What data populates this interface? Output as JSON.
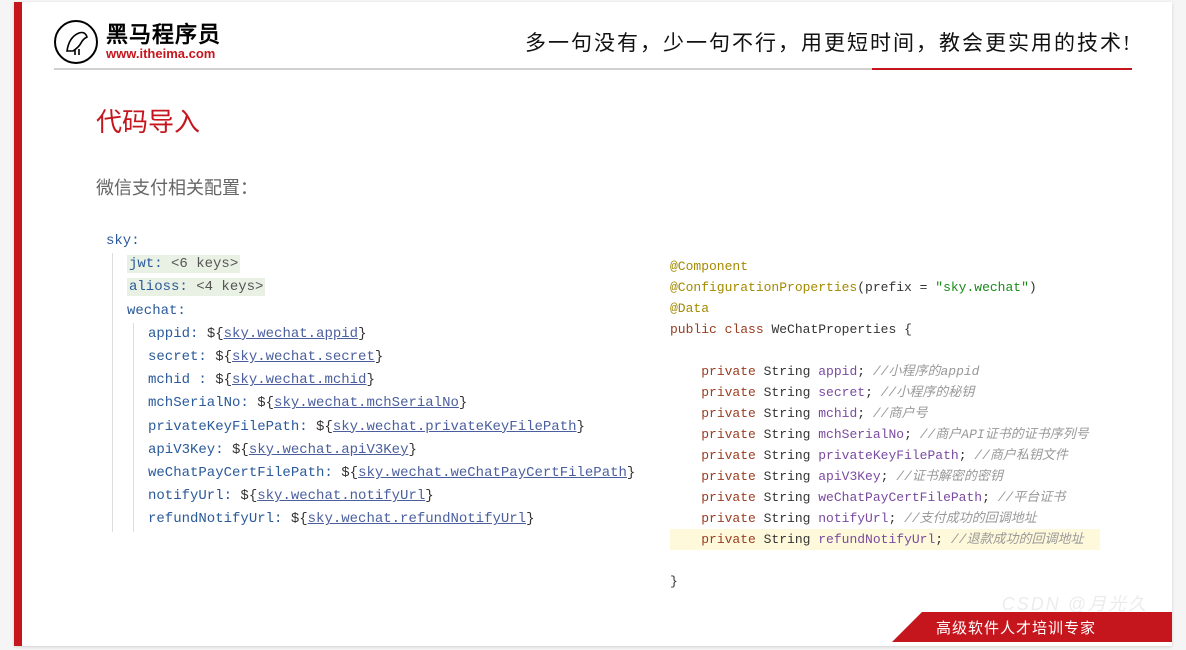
{
  "logo": {
    "cn": "黑马程序员",
    "url": "www.itheima.com"
  },
  "tagline": "多一句没有，少一句不行，用更短时间，教会更实用的技术!",
  "title": "代码导入",
  "subtitle": "微信支付相关配置：",
  "yaml": {
    "root": "sky:",
    "jwt_key": "jwt:",
    "jwt_val": "<6 keys>",
    "alioss_key": "alioss:",
    "alioss_val": "<4 keys>",
    "wechat_key": "wechat:",
    "items": [
      {
        "key": "appid:",
        "prefix": "${",
        "link": "sky.wechat.appid",
        "suffix": "}"
      },
      {
        "key": "secret:",
        "prefix": "${",
        "link": "sky.wechat.secret",
        "suffix": "}"
      },
      {
        "key": "mchid :",
        "prefix": "${",
        "link": "sky.wechat.mchid",
        "suffix": "}"
      },
      {
        "key": "mchSerialNo:",
        "prefix": "${",
        "link": "sky.wechat.mchSerialNo",
        "suffix": "}"
      },
      {
        "key": "privateKeyFilePath:",
        "prefix": "${",
        "link": "sky.wechat.privateKeyFilePath",
        "suffix": "}"
      },
      {
        "key": "apiV3Key:",
        "prefix": "${",
        "link": "sky.wechat.apiV3Key",
        "suffix": "}"
      },
      {
        "key": "weChatPayCertFilePath:",
        "prefix": "${",
        "link": "sky.wechat.weChatPayCertFilePath",
        "suffix": "}"
      },
      {
        "key": "notifyUrl:",
        "prefix": "${",
        "link": "sky.wechat.notifyUrl",
        "suffix": "}"
      },
      {
        "key": "refundNotifyUrl:",
        "prefix": "${",
        "link": "sky.wechat.refundNotifyUrl",
        "suffix": "}"
      }
    ]
  },
  "java": {
    "a1": "@Component",
    "a2_name": "@ConfigurationProperties",
    "a2_arg_k": "prefix = ",
    "a2_arg_v": "\"sky.wechat\"",
    "a3": "@Data",
    "kw_public": "public",
    "kw_class": "class",
    "cls": "WeChatProperties",
    "brace_open": "{",
    "brace_close": "}",
    "kw_private": "private",
    "ty_string": "String",
    "fields": [
      {
        "name": "appid",
        "comment": "//小程序的appid"
      },
      {
        "name": "secret",
        "comment": "//小程序的秘钥"
      },
      {
        "name": "mchid",
        "comment": "//商户号"
      },
      {
        "name": "mchSerialNo",
        "comment": "//商户API证书的证书序列号"
      },
      {
        "name": "privateKeyFilePath",
        "comment": "//商户私钥文件"
      },
      {
        "name": "apiV3Key",
        "comment": "//证书解密的密钥"
      },
      {
        "name": "weChatPayCertFilePath",
        "comment": "//平台证书"
      },
      {
        "name": "notifyUrl",
        "comment": "//支付成功的回调地址"
      },
      {
        "name": "refundNotifyUrl",
        "comment": "//退款成功的回调地址",
        "hl": true
      }
    ]
  },
  "footer": "高级软件人才培训专家",
  "watermark": "CSDN @月光久"
}
